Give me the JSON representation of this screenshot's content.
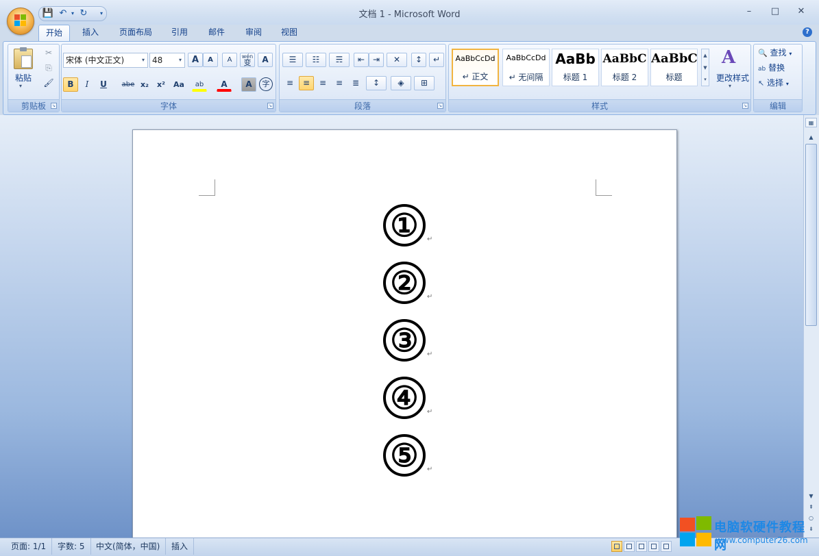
{
  "window": {
    "title": "文档 1 - Microsoft Word",
    "minimize": "–",
    "maximize": "□",
    "close": "✕"
  },
  "quick_access": {
    "save": "💾",
    "undo": "↶",
    "undo_arrow": "▾",
    "redo": "↻",
    "customize": "▾"
  },
  "tabs": [
    "开始",
    "插入",
    "页面布局",
    "引用",
    "邮件",
    "审阅",
    "视图"
  ],
  "help": "?",
  "ribbon": {
    "clipboard": {
      "label": "剪贴板",
      "paste_label": "粘贴",
      "paste_arrow": "▾",
      "cut": "✂",
      "copy": "⎘",
      "format_painter": "🖌"
    },
    "font": {
      "label": "字体",
      "font_name": "宋体 (中文正文)",
      "font_size": "48",
      "grow": "A",
      "shrink": "A",
      "clear_format": "A",
      "phonetic": "wén",
      "phonetic_char": "变",
      "char_border": "A",
      "bold": "B",
      "italic": "I",
      "underline": "U",
      "strike": "abe",
      "subscript": "x₂",
      "superscript": "x²",
      "change_case": "Aa",
      "highlight": "ab",
      "font_color": "A",
      "char_shading": "A",
      "enclose": "字"
    },
    "paragraph": {
      "label": "段落",
      "bullets": "☰",
      "numbering": "☷",
      "multilevel": "☴",
      "decrease_indent": "⇤",
      "increase_indent": "⇥",
      "chinese_layout": "✕",
      "sort": "↕",
      "show_marks": "↵",
      "align_left": "≡",
      "align_center": "≡",
      "align_right": "≡",
      "justify": "≡",
      "distributed": "≣",
      "line_spacing": "↕",
      "shading": "◈",
      "borders": "⊞"
    },
    "styles": {
      "label": "样式",
      "items": [
        {
          "sample": "AaBbCcDd",
          "name": "↵ 正文"
        },
        {
          "sample": "AaBbCcDd",
          "name": "↵ 无间隔"
        },
        {
          "sample": "AaBb",
          "name": "标题 1"
        },
        {
          "sample": "AaBbC",
          "name": "标题 2"
        },
        {
          "sample": "AaBbC",
          "name": "标题"
        }
      ],
      "change_styles": "更改样式",
      "change_styles_arrow": "▾"
    },
    "editing": {
      "label": "编辑",
      "find": "查找",
      "replace": "替换",
      "select": "选择"
    }
  },
  "document": {
    "paragraphs": [
      "①",
      "②",
      "③",
      "④",
      "⑤"
    ],
    "para_mark": "↵"
  },
  "statusbar": {
    "page": "页面: 1/1",
    "words": "字数: 5",
    "language": "中文(简体，中国)",
    "mode": "插入"
  },
  "watermark": {
    "title": "电脑软硬件教程网",
    "url": "www.computer26.com"
  },
  "colors": {
    "accent": "#15428b",
    "highlight_yellow": "#ffff00",
    "font_red": "#ff0000",
    "selection_border": "#f1b440"
  }
}
